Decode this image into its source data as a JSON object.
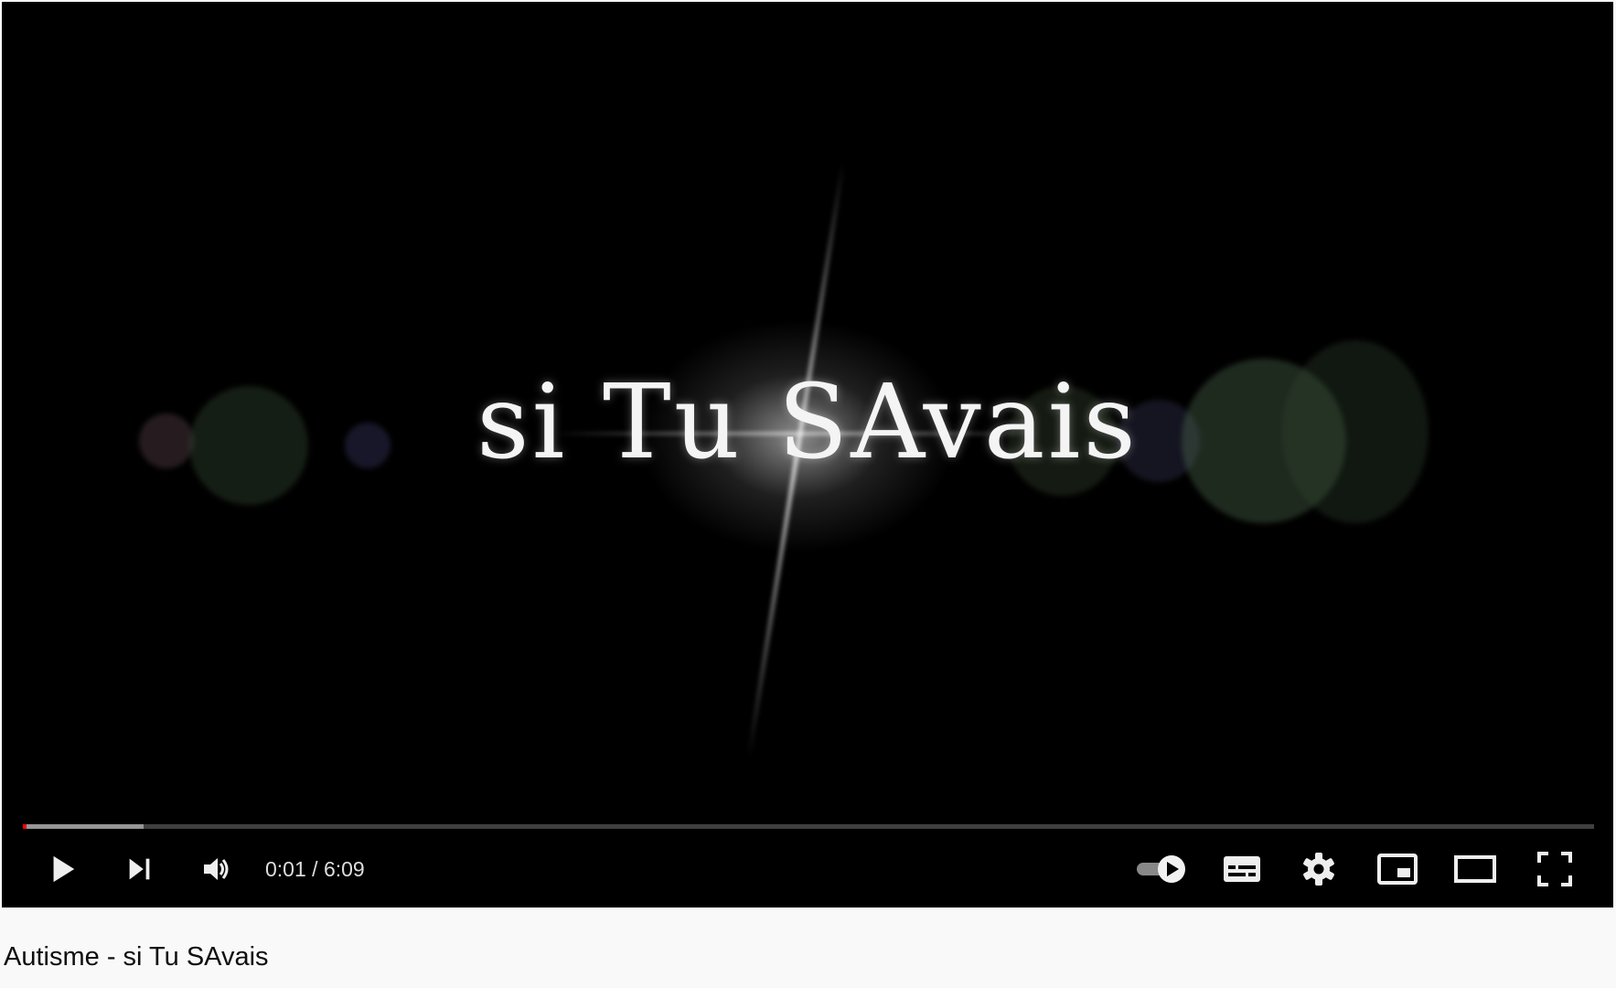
{
  "video": {
    "overlay_text": "si Tu SAvais",
    "current_time": "0:01",
    "separator": " / ",
    "duration": "6:09",
    "played_fraction": 0.0025,
    "buffered_fraction": 0.077
  },
  "controls": {
    "left": [
      "play-icon",
      "next-icon",
      "volume-icon"
    ],
    "right": [
      "autoplay-toggle-icon",
      "subtitles-icon",
      "settings-gear-icon",
      "miniplayer-icon",
      "theater-mode-icon",
      "fullscreen-icon"
    ]
  },
  "colors": {
    "progress_played": "#ff0000",
    "player_background": "#000000",
    "page_background": "#f9f9f9"
  },
  "page": {
    "video_title": "Autisme - si Tu SAvais"
  }
}
